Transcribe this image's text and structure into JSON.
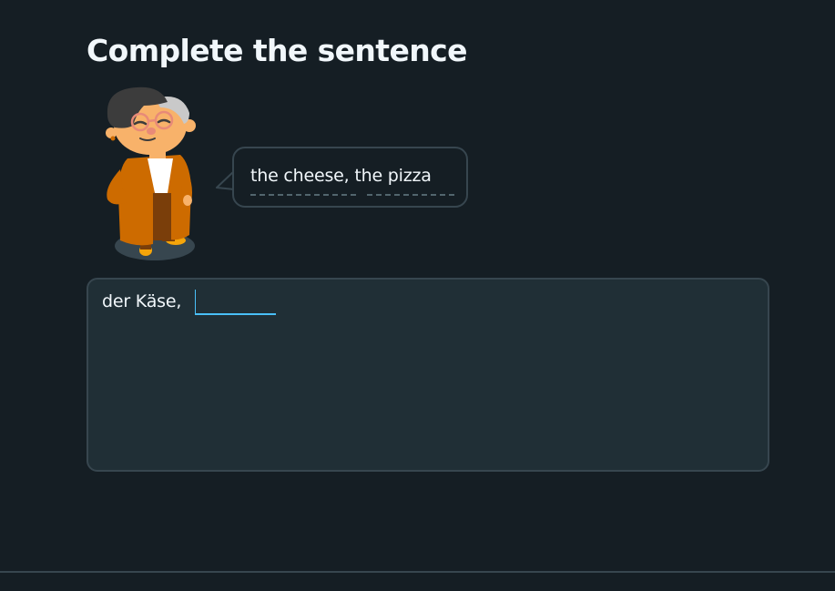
{
  "challenge": {
    "title": "Complete the sentence"
  },
  "hint": {
    "sentence": "the cheese, the pizza",
    "words": [
      "the cheese,",
      "the pizza"
    ]
  },
  "answer": {
    "prefix": "der Käse,",
    "input_value": ""
  },
  "character": {
    "icon": "character-illustration"
  },
  "colors": {
    "background": "#151e24",
    "panel": "#202f36",
    "border": "#37464f",
    "accent": "#49c0f8",
    "text": "#f1f7fb"
  }
}
